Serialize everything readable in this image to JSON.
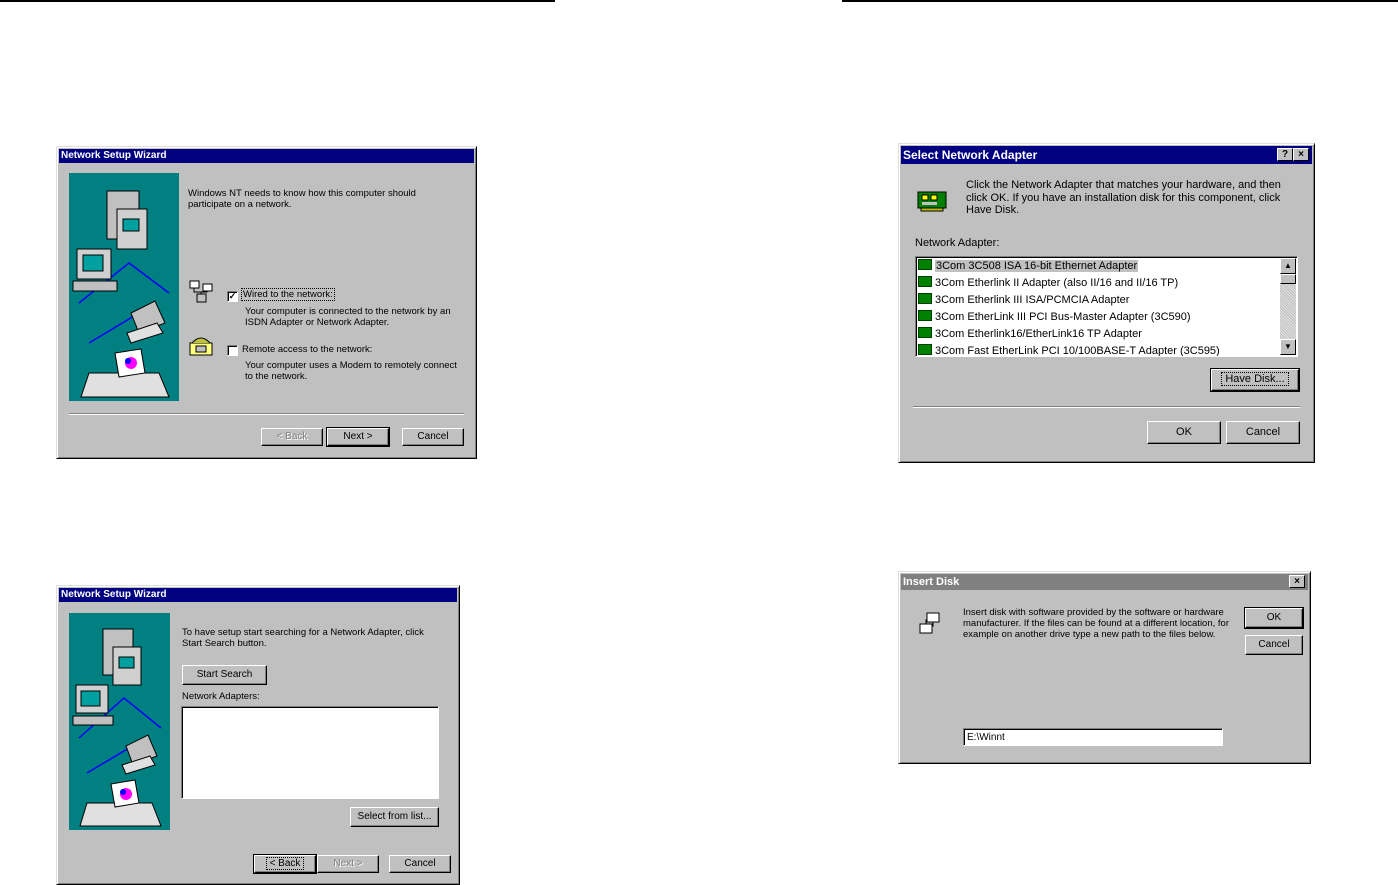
{
  "wizard1": {
    "title": "Network Setup Wizard",
    "intro": "Windows NT needs to know how this computer should participate on a network.",
    "opt_wired_label": "Wired to the network:",
    "opt_wired_checked": true,
    "opt_wired_desc": "Your computer is connected to the network by an ISDN Adapter or Network Adapter.",
    "opt_remote_label": "Remote access to the network:",
    "opt_remote_checked": false,
    "opt_remote_desc": "Your computer uses a Modem to remotely connect to the network.",
    "back": "< Back",
    "next": "Next >",
    "cancel": "Cancel"
  },
  "wizard2": {
    "title": "Network Setup Wizard",
    "intro": "To have setup start searching for a Network Adapter, click Start Search button.",
    "start_search": "Start Search",
    "adapters_label": "Network Adapters:",
    "select_from_list": "Select from list...",
    "back": "< Back",
    "next": "Next >",
    "cancel": "Cancel"
  },
  "select_adapter": {
    "title": "Select Network Adapter",
    "help_btn": "?",
    "close_btn": "×",
    "instruction": "Click the Network Adapter that matches your hardware, and then click OK.  If you have an installation disk for this component, click Have Disk.",
    "list_label": "Network Adapter:",
    "items": [
      "3Com 3C508 ISA 16-bit Ethernet Adapter",
      "3Com Etherlink II Adapter (also II/16 and II/16 TP)",
      "3Com Etherlink III ISA/PCMCIA Adapter",
      "3Com EtherLink III PCI Bus-Master Adapter (3C590)",
      "3Com Etherlink16/EtherLink16 TP Adapter",
      "3Com Fast EtherLink PCI 10/100BASE-T Adapter (3C595)"
    ],
    "selected_index": 0,
    "have_disk": "Have Disk...",
    "ok": "OK",
    "cancel": "Cancel"
  },
  "insert_disk": {
    "title": "Insert Disk",
    "close_btn": "×",
    "message": "Insert disk with software provided by the software or hardware manufacturer.  If the files can be found at a different location, for example on another drive type a new path to the files below.",
    "path_value": "E:\\Winnt",
    "ok": "OK",
    "cancel": "Cancel"
  }
}
